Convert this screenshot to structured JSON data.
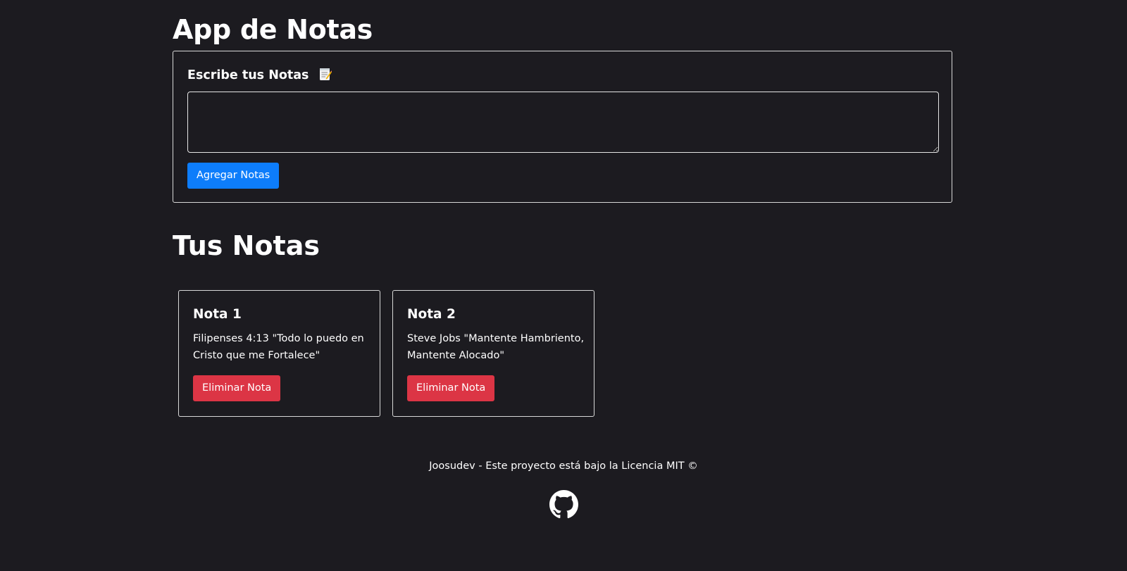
{
  "app": {
    "title": "App de Notas"
  },
  "add_note": {
    "label": "Escribe tus Notas",
    "label_icon": "memo-icon",
    "textarea_value": "",
    "button_label": "Agregar Notas"
  },
  "notes_section": {
    "title": "Tus Notas",
    "notes": [
      {
        "title": "Nota 1",
        "text": "Filipenses 4:13 \"Todo lo puedo en Cristo que me Fortalece\"",
        "delete_label": "Eliminar Nota"
      },
      {
        "title": "Nota 2",
        "text": "Steve Jobs \"Mantente Hambriento, Mantente Alocado\"",
        "delete_label": "Eliminar Nota"
      }
    ]
  },
  "footer": {
    "text": "Joosudev - Este proyecto está bajo la Licencia MIT ©",
    "icon": "github-icon"
  },
  "colors": {
    "background": "#1c1b20",
    "primary": "#0d7dfb",
    "danger": "#dc3545",
    "border": "#d8d8d8"
  }
}
